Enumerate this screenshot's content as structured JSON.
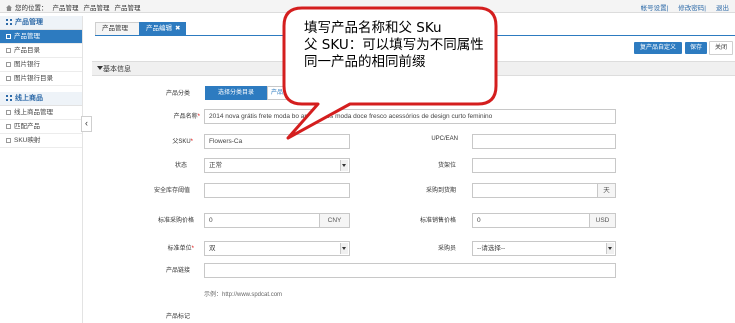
{
  "breadcrumb": {
    "items": [
      "您的位置：",
      "产品管理",
      "产品管理",
      "产品管理"
    ]
  },
  "top_links": [
    "帐号设置",
    "修改密码",
    "退出"
  ],
  "sidebar": {
    "sections": [
      {
        "title": "产品管理",
        "items": [
          "产品管理",
          "产品目录",
          "图片银行",
          "图片银行目录"
        ]
      },
      {
        "title": "线上商品",
        "items": [
          "线上商品管理",
          "匹配产品",
          "SKU映射"
        ]
      }
    ]
  },
  "tabs": [
    {
      "label": "产品管理"
    },
    {
      "label": "产品编辑"
    }
  ],
  "actions": {
    "copy_label": "复产品自定义",
    "save_label": "保存",
    "close_label": "关闭"
  },
  "section": {
    "title": "基本信息"
  },
  "form": {
    "category": {
      "label": "产品分类",
      "button": "选择分类目录",
      "second": "产品分类"
    },
    "name": {
      "label": "产品名称",
      "required": "*",
      "value": "2014 nova grátis frete moda bo          ar de flores moda doce fresco acessórios de design curto feminino"
    },
    "parent_sku": {
      "label": "父SKU",
      "required": "*",
      "value": "Flowers-Ca"
    },
    "upc": {
      "label": "UPC/EAN",
      "value": ""
    },
    "status": {
      "label": "状态",
      "value": "正常"
    },
    "shelf": {
      "label": "货架位",
      "value": ""
    },
    "safety_stock": {
      "label": "安全库存阈值",
      "value": ""
    },
    "purchase_days": {
      "label": "采购到货期",
      "value": "",
      "unit": "天"
    },
    "purchase_price": {
      "label": "标准采购价格",
      "value": "0",
      "currency": "CNY"
    },
    "sale_price": {
      "label": "标准销售价格",
      "value": "0",
      "currency": "USD"
    },
    "unit": {
      "label": "标准单位",
      "required": "*",
      "value": "双"
    },
    "buyer": {
      "label": "采购员",
      "value": "--请选择--"
    },
    "link": {
      "label": "产品链接",
      "value": "",
      "hint": "示例：http://www.spdcat.com"
    },
    "tag": {
      "label": "产品标记"
    }
  },
  "callout": {
    "lines": [
      "填写产品名称和父 SKu",
      "父 SKU：可以填写为不同属性",
      "同一产品的相同前缀"
    ]
  }
}
